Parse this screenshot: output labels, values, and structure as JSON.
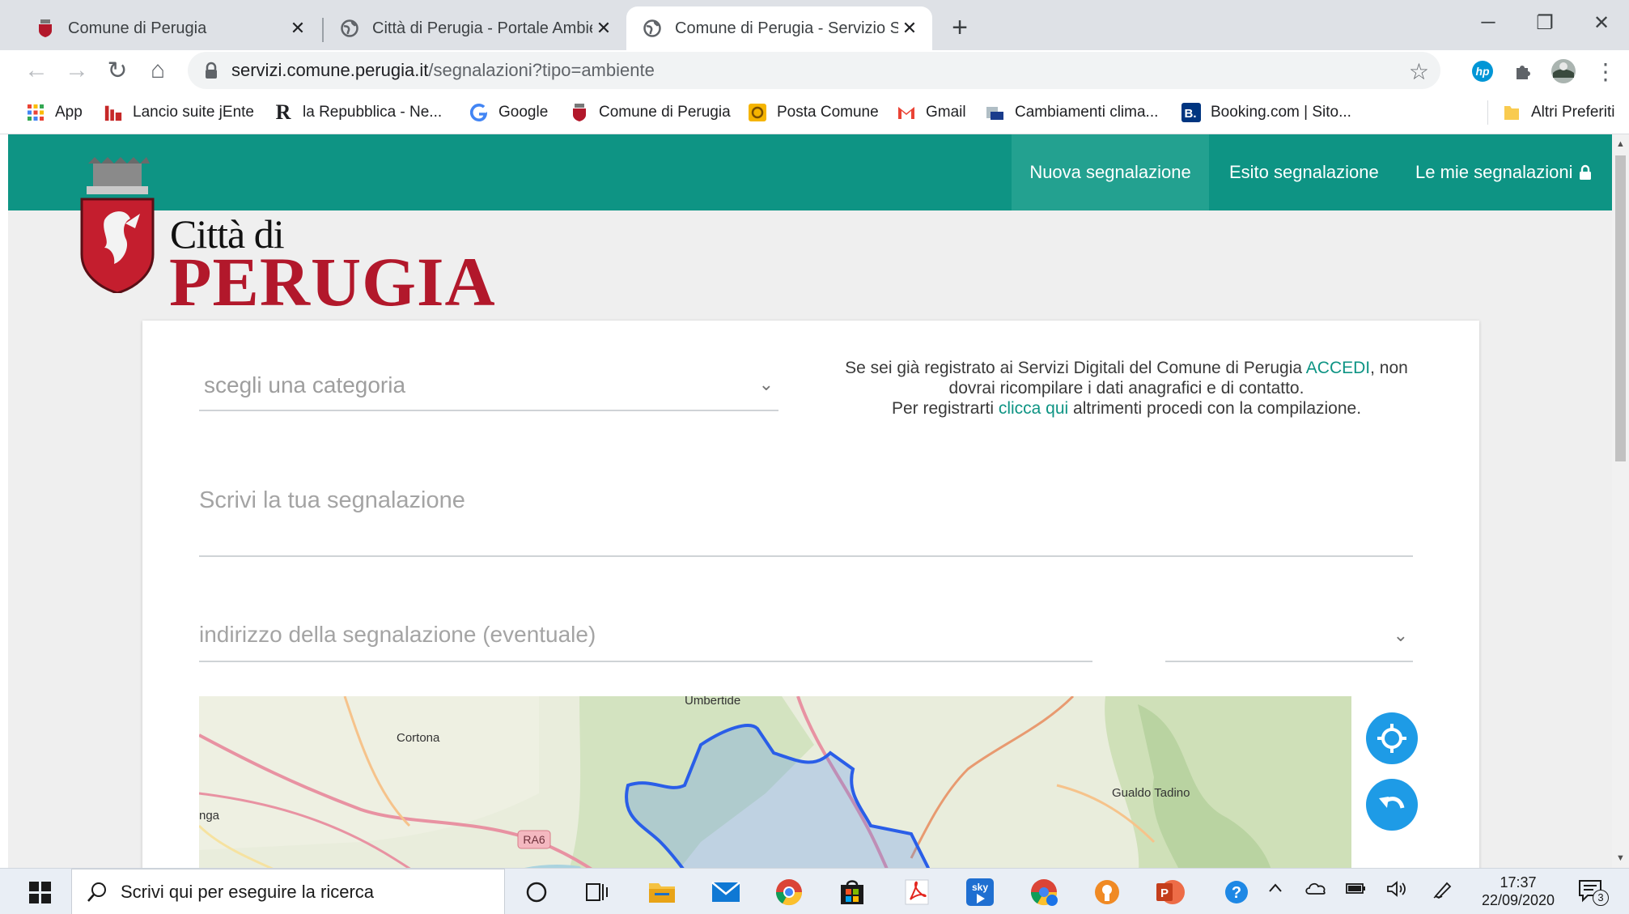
{
  "browser": {
    "tabs": [
      {
        "title": "Comune di Perugia",
        "close": "✕",
        "active": false
      },
      {
        "title": "Città di Perugia - Portale Ambiente",
        "close": "✕",
        "active": false
      },
      {
        "title": "Comune di Perugia - Servizio Segnalazioni",
        "close": "✕",
        "active": true
      }
    ],
    "new_tab": "+",
    "window_controls": {
      "minimize": "─",
      "restore": "❐",
      "close": "✕"
    },
    "nav": {
      "back": "←",
      "forward": "→",
      "reload": "↻",
      "home": "⌂"
    },
    "url": {
      "host": "servizi.comune.perugia.it",
      "path": "/segnalazioni?tipo=ambiente"
    },
    "bookmarks": [
      {
        "label": "App",
        "icon": "apps-grid-icon"
      },
      {
        "label": "Lancio suite jEnte",
        "icon": "jente-icon"
      },
      {
        "label": "la Repubblica - Ne...",
        "icon": "repubblica-icon"
      },
      {
        "label": "Google",
        "icon": "google-icon"
      },
      {
        "label": "Comune di Perugia",
        "icon": "perugia-crest-icon"
      },
      {
        "label": "Posta Comune",
        "icon": "mail-icon"
      },
      {
        "label": "Gmail",
        "icon": "gmail-icon"
      },
      {
        "label": "Cambiamenti clima...",
        "icon": "page-icon"
      },
      {
        "label": "Booking.com | Sito...",
        "icon": "booking-icon"
      }
    ],
    "other_bookmarks": "Altri Preferiti"
  },
  "site": {
    "logo": {
      "line1": "Città di",
      "line2": "PERUGIA"
    },
    "nav": [
      {
        "label": "Nuova segnalazione",
        "active": true
      },
      {
        "label": "Esito segnalazione",
        "active": false
      },
      {
        "label": "Le mie segnalazioni",
        "active": false
      }
    ],
    "lock_glyph": "🔒"
  },
  "form": {
    "category_placeholder": "scegli una categoria",
    "chevron": "⌄",
    "info": {
      "line1_pre": "Se sei già registrato ai Servizi Digitali del Comune di Perugia ",
      "line1_link": "ACCEDI",
      "line1_post": ", non dovrai ricompilare i dati anagrafici e di contatto.",
      "line2_pre": "Per registrarti ",
      "line2_link": "clicca qui",
      "line2_post": " altrimenti procedi con la compilazione."
    },
    "report_placeholder": "Scrivi la tua segnalazione",
    "address_placeholder": "indirizzo della segnalazione (eventuale)"
  },
  "map": {
    "labels": {
      "umbertide": "Umbertide",
      "cortona": "Cortona",
      "gualdo": "Gualdo Tadino",
      "left": "nga",
      "road": "RA6"
    }
  },
  "taskbar": {
    "search_placeholder": "Scrivi qui per eseguire la ricerca",
    "time": "17:37",
    "date": "22/09/2020",
    "notifications": "3"
  }
}
